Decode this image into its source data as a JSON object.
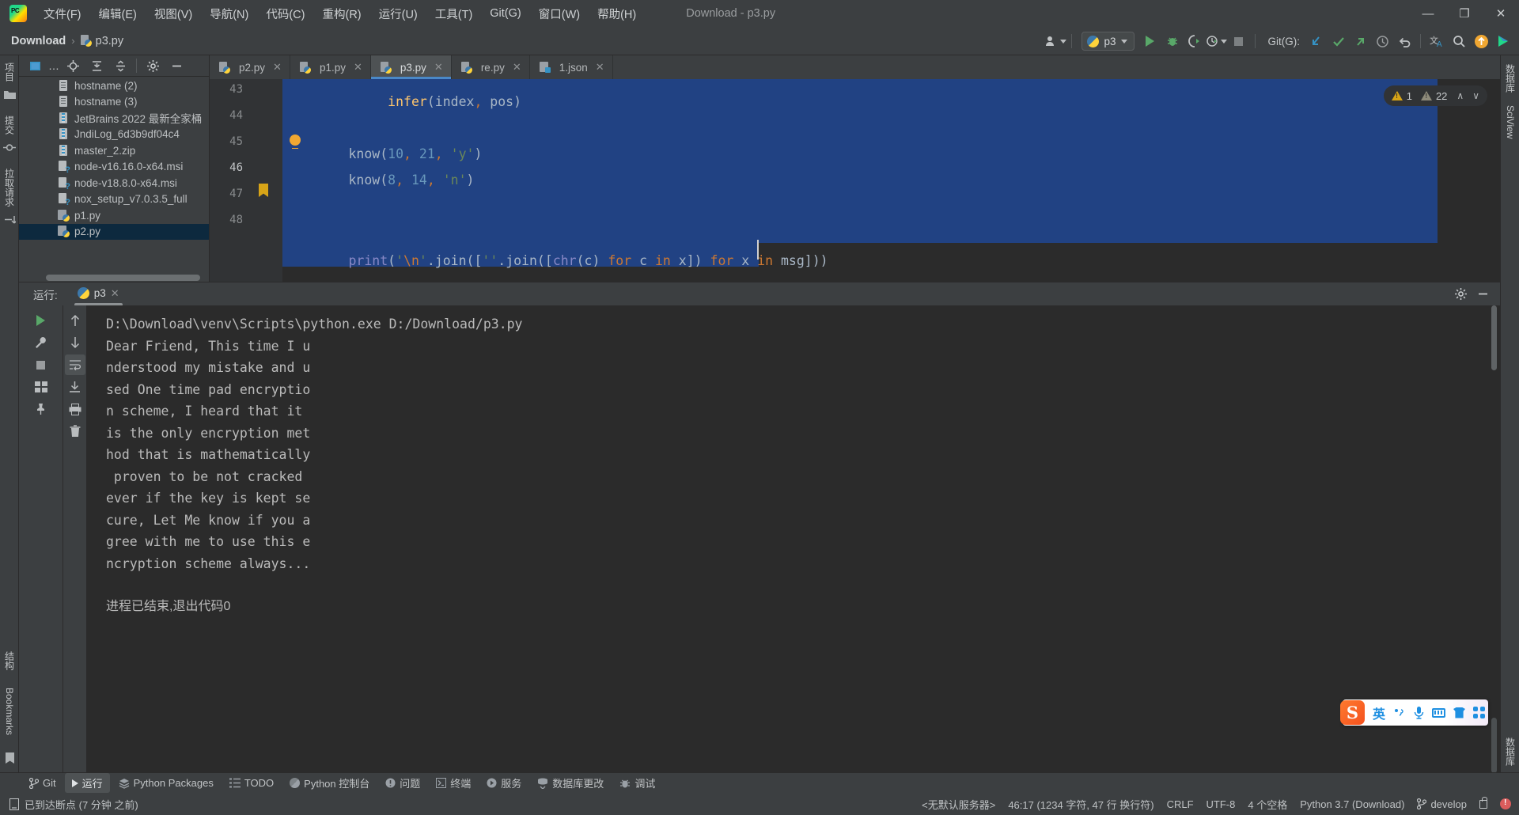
{
  "window": {
    "title": "Download - p3.py",
    "logo": "pycharm-logo",
    "minimize": "—",
    "maximize": "❐",
    "close": "✕"
  },
  "menubar": {
    "items": [
      {
        "label": "文件(F)",
        "name": "menu-file"
      },
      {
        "label": "编辑(E)",
        "name": "menu-edit"
      },
      {
        "label": "视图(V)",
        "name": "menu-view"
      },
      {
        "label": "导航(N)",
        "name": "menu-navigate"
      },
      {
        "label": "代码(C)",
        "name": "menu-code"
      },
      {
        "label": "重构(R)",
        "name": "menu-refactor"
      },
      {
        "label": "运行(U)",
        "name": "menu-run"
      },
      {
        "label": "工具(T)",
        "name": "menu-tools"
      },
      {
        "label": "Git(G)",
        "name": "menu-git"
      },
      {
        "label": "窗口(W)",
        "name": "menu-window"
      },
      {
        "label": "帮助(H)",
        "name": "menu-help"
      }
    ]
  },
  "breadcrumb": {
    "project": "Download",
    "separator": "›",
    "file": "p3.py"
  },
  "toolbar": {
    "run_config": "p3",
    "git_label": "Git(G):",
    "icons": [
      "account-icon",
      "run-icon",
      "debug-icon",
      "coverage-icon",
      "profile-icon",
      "stop-icon",
      "git-update-icon",
      "git-commit-icon",
      "git-push-icon",
      "git-history-icon",
      "git-rollback-icon",
      "translate-icon",
      "search-icon",
      "upload-icon",
      "plugin-icon"
    ]
  },
  "left_strip": {
    "items": [
      {
        "label": "项目",
        "name": "tool-project"
      },
      {
        "label": "提交",
        "name": "tool-commit"
      },
      {
        "label": "拉取请求",
        "name": "tool-pull-requests"
      }
    ],
    "bottom_items": [
      {
        "label": "Bookmarks",
        "name": "tool-bookmarks"
      },
      {
        "label": "结构",
        "name": "tool-structure"
      }
    ]
  },
  "right_strip": {
    "items": [
      {
        "label": "数据库",
        "name": "tool-database"
      },
      {
        "label": "SciView",
        "name": "tool-sciview"
      },
      {
        "label": "数据库",
        "name": "tool-notifications"
      }
    ]
  },
  "project_panel": {
    "toolbar_icons": [
      "select-opened-file-icon",
      "more-icon",
      "locate-icon",
      "collapse-all-icon",
      "expand-icon",
      "settings-icon",
      "hide-icon"
    ],
    "tree": [
      {
        "label": "hostname (2)",
        "icon": "doc",
        "selected": false
      },
      {
        "label": "hostname (3)",
        "icon": "doc",
        "selected": false
      },
      {
        "label": "JetBrains 2022 最新全家桶",
        "icon": "zip",
        "selected": false
      },
      {
        "label": "JndiLog_6d3b9df04c4",
        "icon": "zip",
        "selected": false
      },
      {
        "label": "master_2.zip",
        "icon": "zip",
        "selected": false
      },
      {
        "label": "node-v16.16.0-x64.msi",
        "icon": "unknown",
        "selected": false
      },
      {
        "label": "node-v18.8.0-x64.msi",
        "icon": "unknown",
        "selected": false
      },
      {
        "label": "nox_setup_v7.0.3.5_full",
        "icon": "unknown",
        "selected": false
      },
      {
        "label": "p1.py",
        "icon": "python",
        "selected": false
      },
      {
        "label": "p2.py",
        "icon": "python",
        "selected": true
      }
    ]
  },
  "editor": {
    "tabs": [
      {
        "label": "p2.py",
        "icon": "python",
        "active": false,
        "close": "✕"
      },
      {
        "label": "p1.py",
        "icon": "python",
        "active": false,
        "close": "✕"
      },
      {
        "label": "p3.py",
        "icon": "python",
        "active": true,
        "close": "✕"
      },
      {
        "label": "re.py",
        "icon": "python",
        "active": false,
        "close": "✕"
      },
      {
        "label": "1.json",
        "icon": "json",
        "active": false,
        "close": "✕"
      }
    ],
    "lines": [
      {
        "number": "43",
        "text": "    infer(index, pos)",
        "bookmark": false
      },
      {
        "number": "44",
        "text": "",
        "bookmark": false
      },
      {
        "number": "45",
        "text": "know(10, 21, 'y')",
        "bookmark": false
      },
      {
        "number": "46",
        "text": "know(8, 14, 'n')",
        "bookmark": false
      },
      {
        "number": "47",
        "text": "",
        "bookmark": true
      },
      {
        "number": "48",
        "text": "print('\\n'.join([''.join([chr(c) for c in x]) for x in msg]))",
        "bookmark": false
      }
    ],
    "inspection": {
      "warning_count": "1",
      "weak_warning_count": "22",
      "up_arrow": "∧",
      "down_arrow": "∨"
    }
  },
  "run_panel": {
    "title": "运行:",
    "tab_label": "p3",
    "tab_close": "✕",
    "side_icons": [
      "rerun-icon",
      "stop-icon",
      "trash-icon",
      "wrench-icon",
      "up-arrow-icon",
      "down-arrow-icon",
      "soft-wrap-icon",
      "scroll-to-end-icon",
      "print-icon",
      "pin-icon"
    ],
    "header_icons": [
      "settings-icon",
      "hide-icon"
    ],
    "output": [
      "D:\\Download\\venv\\Scripts\\python.exe D:/Download/p3.py",
      "Dear Friend, This time I u",
      "nderstood my mistake and u",
      "sed One time pad encryptio",
      "n scheme, I heard that it",
      "is the only encryption met",
      "hod that is mathematically",
      " proven to be not cracked",
      "ever if the key is kept se",
      "cure, Let Me know if you a",
      "gree with me to use this e",
      "ncryption scheme always...",
      "",
      "进程已结束,退出代码0"
    ]
  },
  "tool_window_bar": {
    "items": [
      {
        "label": "Git",
        "icon": "git-branch-icon",
        "active": false,
        "name": "toolwin-git"
      },
      {
        "label": "运行",
        "icon": "run-icon",
        "active": true,
        "name": "toolwin-run"
      },
      {
        "label": "Python Packages",
        "icon": "packages-icon",
        "active": false,
        "name": "toolwin-python-packages"
      },
      {
        "label": "TODO",
        "icon": "todo-icon",
        "active": false,
        "name": "toolwin-todo"
      },
      {
        "label": "Python 控制台",
        "icon": "python-console-icon",
        "active": false,
        "name": "toolwin-python-console"
      },
      {
        "label": "问题",
        "icon": "problems-icon",
        "active": false,
        "name": "toolwin-problems"
      },
      {
        "label": "终端",
        "icon": "terminal-icon",
        "active": false,
        "name": "toolwin-terminal"
      },
      {
        "label": "服务",
        "icon": "services-icon",
        "active": false,
        "name": "toolwin-services"
      },
      {
        "label": "数据库更改",
        "icon": "db-changes-icon",
        "active": false,
        "name": "toolwin-db-changes"
      },
      {
        "label": "调试",
        "icon": "debug-icon",
        "active": false,
        "name": "toolwin-debug"
      }
    ]
  },
  "statusbar": {
    "message": "已到达断点 (7 分钟 之前)",
    "message_icon": "breakpoint-icon",
    "server": "<无默认服务器>",
    "caret": "46:17 (1234 字符, 47 行 换行符)",
    "line_sep": "CRLF",
    "encoding": "UTF-8",
    "indent": "4 个空格",
    "interpreter": "Python 3.7 (Download)",
    "branch": "develop",
    "branch_icon": "git-branch-icon",
    "lock_icon": "lock-icon",
    "error_icon": "error-icon"
  },
  "ime": {
    "logo": "S",
    "mode": "英",
    "icons": [
      "punctuation-icon",
      "microphone-icon",
      "keyboard-icon",
      "skin-icon",
      "toolbox-icon"
    ]
  },
  "colors": {
    "background": "#3c3f41",
    "editor_bg": "#2b2b2b",
    "selection": "#214283",
    "accent": "#4a88c7",
    "tree_selected": "#0d293e",
    "warning": "#d7a417",
    "run_green": "#59a869",
    "string_green": "#6a8759",
    "keyword_orange": "#cc7832",
    "number_blue": "#6897bb",
    "function_yellow": "#ffc66d"
  }
}
